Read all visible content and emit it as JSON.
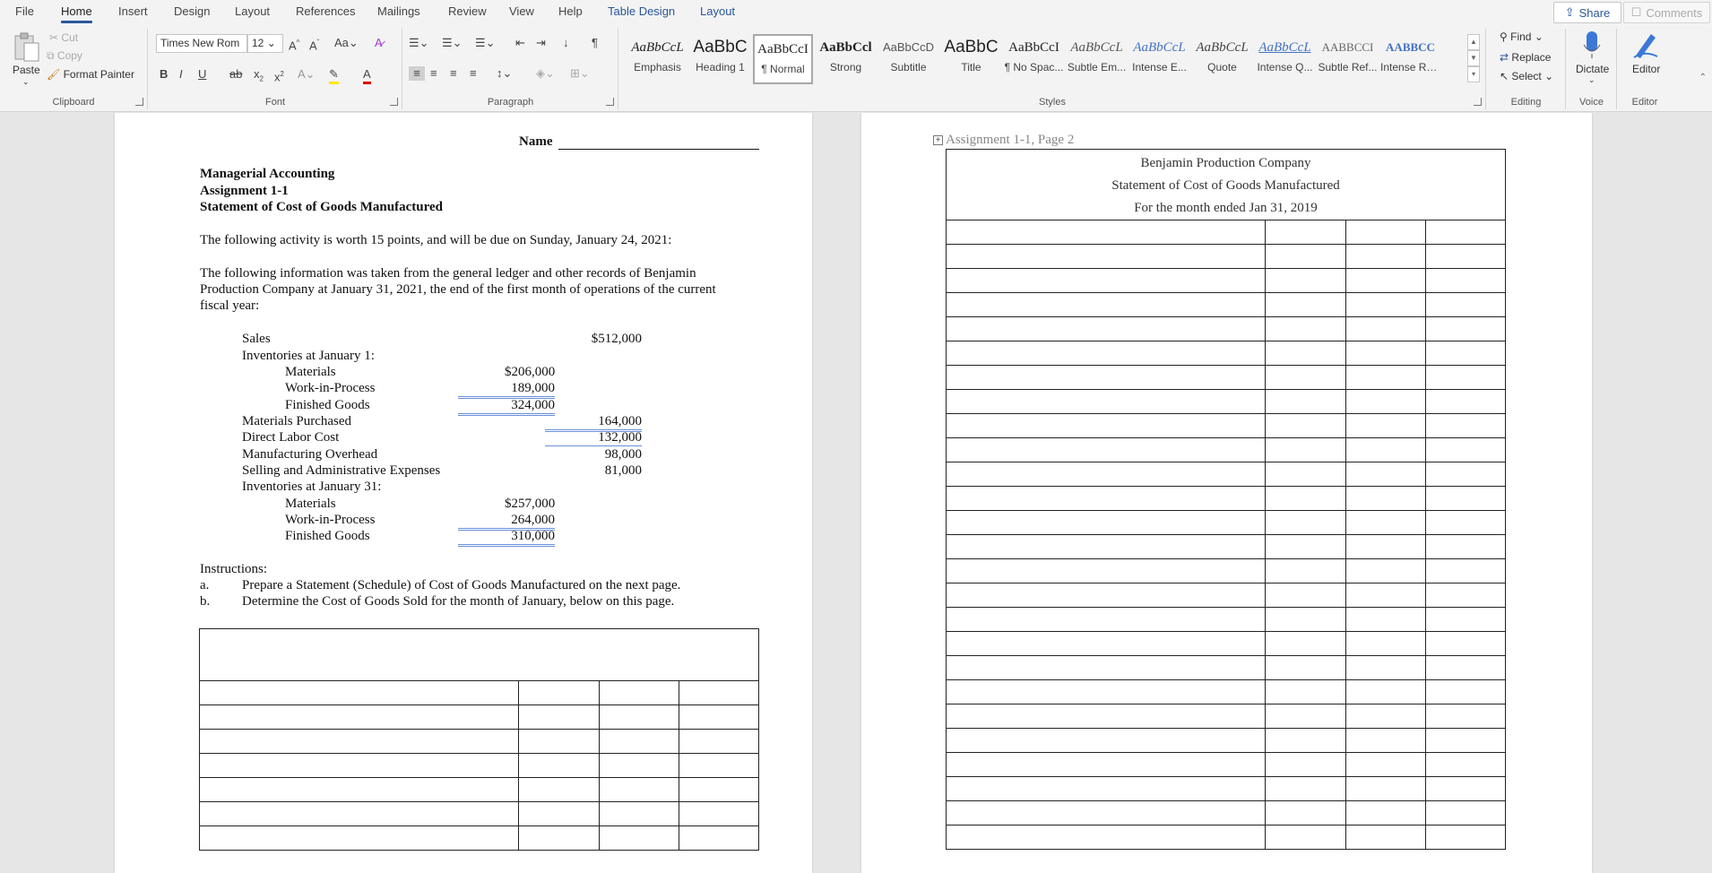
{
  "menu": {
    "tabs": [
      "File",
      "Home",
      "Insert",
      "Design",
      "Layout",
      "References",
      "Mailings",
      "Review",
      "View",
      "Help"
    ],
    "context_tabs": [
      "Table Design",
      "Layout"
    ],
    "active": "Home",
    "share": "Share",
    "comments": "Comments"
  },
  "ribbon": {
    "clipboard": {
      "label": "Clipboard",
      "paste": "Paste",
      "cut": "Cut",
      "copy": "Copy",
      "format_painter": "Format Painter"
    },
    "font": {
      "label": "Font",
      "name": "Times New Rom",
      "size": "12"
    },
    "paragraph": {
      "label": "Paragraph"
    },
    "styles": {
      "label": "Styles",
      "items": [
        {
          "preview": "AaBbCcL",
          "name": "Emphasis"
        },
        {
          "preview": "AaBbC",
          "name": "Heading 1"
        },
        {
          "preview": "AaBbCcI",
          "name": "¶ Normal"
        },
        {
          "preview": "AaBbCcl",
          "name": "Strong"
        },
        {
          "preview": "AaBbCcD",
          "name": "Subtitle"
        },
        {
          "preview": "AaBbC",
          "name": "Title"
        },
        {
          "preview": "AaBbCcI",
          "name": "¶ No Spac..."
        },
        {
          "preview": "AaBbCcL",
          "name": "Subtle Em..."
        },
        {
          "preview": "AaBbCcL",
          "name": "Intense E..."
        },
        {
          "preview": "AaBbCcL",
          "name": "Quote"
        },
        {
          "preview": "AaBbCcL",
          "name": "Intense Q..."
        },
        {
          "preview": "AABBCCI",
          "name": "Subtle Ref..."
        },
        {
          "preview": "AABBCC",
          "name": "Intense Re..."
        }
      ]
    },
    "editing": {
      "label": "Editing",
      "find": "Find",
      "replace": "Replace",
      "select": "Select"
    },
    "voice": {
      "label": "Voice",
      "dictate": "Dictate"
    },
    "editor": {
      "label": "Editor",
      "editor": "Editor"
    }
  },
  "page1": {
    "name_label": "Name",
    "heading": [
      "Managerial Accounting",
      "Assignment 1-1",
      "Statement of Cost of Goods Manufactured"
    ],
    "intro": "The following activity is worth 15 points, and will be due on Sunday, January 24, 2021:",
    "para": [
      "The following information was taken from the general ledger and other records of Benjamin",
      "Production Company at January 31, 2021, the end of the first month of operations of the current",
      "fiscal year:"
    ],
    "ledger": {
      "sales": {
        "label": "Sales",
        "value": "$512,000"
      },
      "inv_jan1": "Inventories at January 1:",
      "materials1": {
        "label": "Materials",
        "value": "$206,000"
      },
      "wip1": {
        "label": "Work-in-Process",
        "value": "189,000"
      },
      "fg1": {
        "label": "Finished Goods",
        "value": "324,000"
      },
      "purch": {
        "label": "Materials Purchased",
        "value": "164,000"
      },
      "labor": {
        "label": "Direct Labor Cost",
        "value": "132,000"
      },
      "overhead": {
        "label": "Manufacturing Overhead",
        "value": "98,000"
      },
      "selling": {
        "label": "Selling and Administrative Expenses",
        "value": "81,000"
      },
      "inv_jan31": "Inventories at January 31:",
      "materials31": {
        "label": "Materials",
        "value": "$257,000"
      },
      "wip31": {
        "label": "Work-in-Process",
        "value": "264,000"
      },
      "fg31": {
        "label": "Finished Goods",
        "value": "310,000"
      }
    },
    "instructions": {
      "title": "Instructions:",
      "a": {
        "marker": "a.",
        "text": "Prepare a Statement (Schedule) of Cost of Goods Manufactured on the next page."
      },
      "b": {
        "marker": "b.",
        "text": "Determine the Cost of Goods Sold for the month of January, below on this page."
      }
    }
  },
  "page2": {
    "caption": "Assignment 1-1, Page 2",
    "company": "Benjamin Production Company",
    "statement": "Statement of Cost of Goods Manufactured",
    "period": "For the month ended Jan 31, 2019"
  }
}
